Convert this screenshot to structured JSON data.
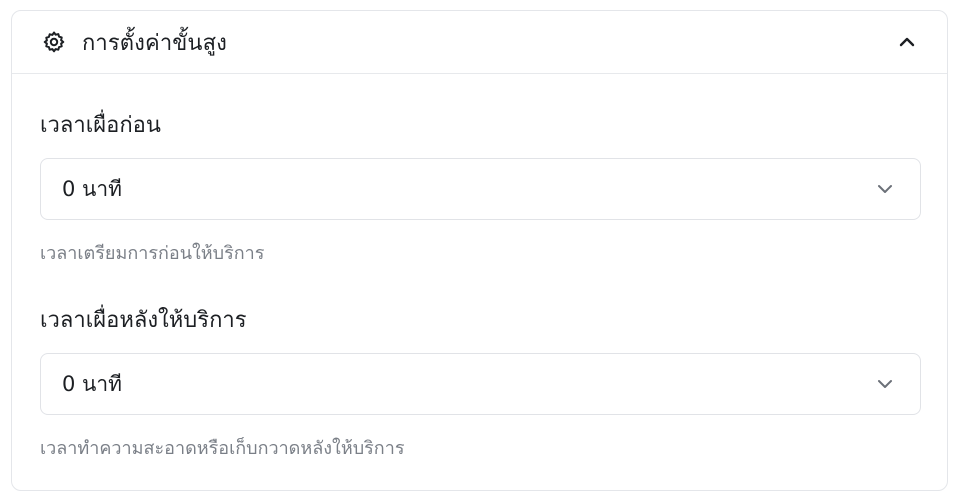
{
  "panel": {
    "title": "การตั้งค่าขั้นสูง",
    "header_icon": "gear-icon",
    "collapse_icon": "chevron-up-icon"
  },
  "fields": [
    {
      "label": "เวลาเผื่อก่อน",
      "value": "0 นาที",
      "hint": "เวลาเตรียมการก่อนให้บริการ"
    },
    {
      "label": "เวลาเผื่อหลังให้บริการ",
      "value": "0 นาที",
      "hint": "เวลาทำความสะอาดหรือเก็บกวาดหลังให้บริการ"
    }
  ]
}
